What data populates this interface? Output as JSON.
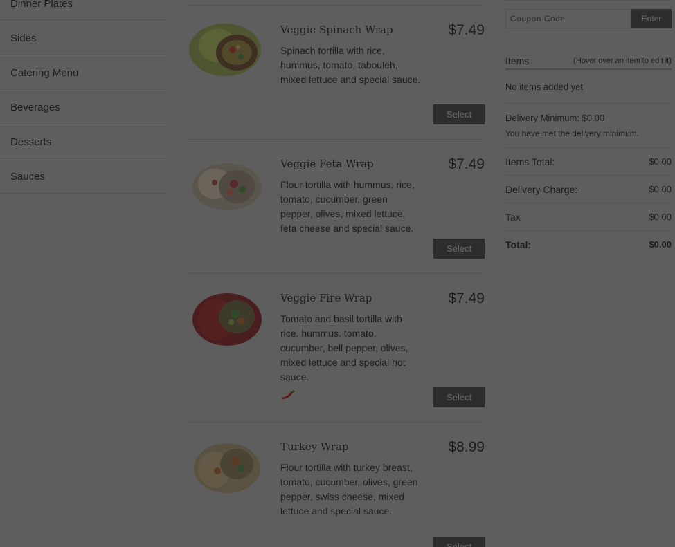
{
  "sidebar": {
    "items": [
      {
        "label": "Dinner Plates"
      },
      {
        "label": "Sides"
      },
      {
        "label": "Catering Menu"
      },
      {
        "label": "Beverages"
      },
      {
        "label": "Desserts"
      },
      {
        "label": "Sauces"
      }
    ]
  },
  "menu": {
    "items": [
      {
        "name": "Veggie Spinach Wrap",
        "price": "$7.49",
        "description": "Spinach tortilla with rice, hummus, tomato, tabouleh, mixed lettuce and special sauce.",
        "select_label": "Select",
        "spicy": false
      },
      {
        "name": "Veggie Feta Wrap",
        "price": "$7.49",
        "description": "Flour tortilla with hummus, rice, tomato, cucumber, green pepper, olives, mixed lettuce, feta cheese and special sauce.",
        "select_label": "Select",
        "spicy": false
      },
      {
        "name": "Veggie Fire Wrap",
        "price": "$7.49",
        "description": "Tomato and basil tortilla with rice, hummus, tomato, cucumber, bell pepper, olives, mixed lettuce and special hot sauce.",
        "select_label": "Select",
        "spicy": true,
        "spicy_icon": "chili-pepper-icon"
      },
      {
        "name": "Turkey Wrap",
        "price": "$8.99",
        "description": "Flour tortilla with turkey breast, tomato, cucumber, olives, green pepper, swiss cheese, mixed lettuce and special sauce.",
        "select_label": "Select",
        "spicy": false
      }
    ]
  },
  "cart": {
    "coupon_placeholder": "Coupon Code",
    "enter_label": "Enter",
    "items_title": "Items",
    "items_hint": "(Hover over an item to edit it)",
    "no_items": "No items added yet",
    "delivery_minimum": "Delivery Minimum: $0.00",
    "delivery_note": "You have met the delivery minimum.",
    "items_total_label": "Items Total:",
    "items_total_value": "$0.00",
    "delivery_charge_label": "Delivery Charge:",
    "delivery_charge_value": "$0.00",
    "tax_label": "Tax",
    "tax_value": "$0.00",
    "total_label": "Total:",
    "total_value": "$0.00"
  },
  "colors": {
    "overlay_bg": "#5e5e5e",
    "button_bg": "#2d2d2d",
    "text": "#1e1e1e"
  }
}
